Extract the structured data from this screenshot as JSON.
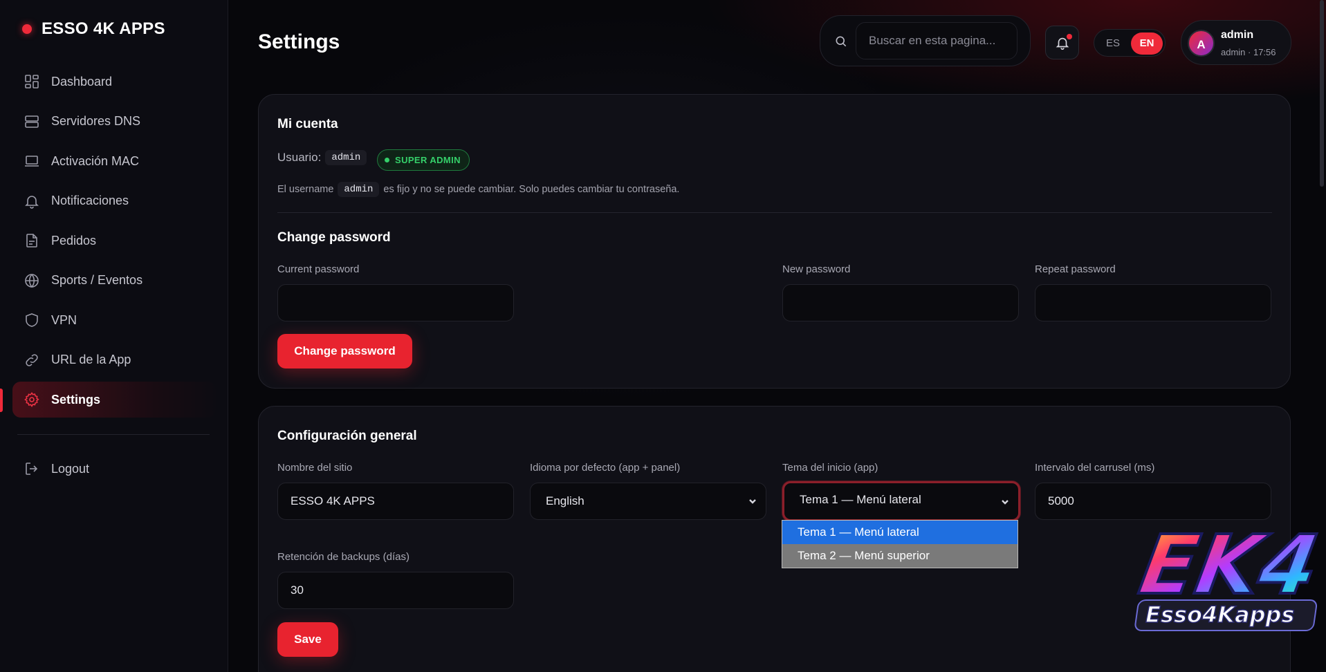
{
  "brand": {
    "name": "ESSO 4K APPS",
    "dot_color": "#ef2a3a"
  },
  "sidebar": {
    "items": [
      {
        "label": "Dashboard",
        "icon": "dashboard-icon"
      },
      {
        "label": "Servidores DNS",
        "icon": "server-icon"
      },
      {
        "label": "Activación MAC",
        "icon": "laptop-icon"
      },
      {
        "label": "Notificaciones",
        "icon": "bell-icon"
      },
      {
        "label": "Pedidos",
        "icon": "document-icon"
      },
      {
        "label": "Sports / Eventos",
        "icon": "globe-icon"
      },
      {
        "label": "VPN",
        "icon": "shield-icon"
      },
      {
        "label": "URL de la App",
        "icon": "link-icon"
      },
      {
        "label": "Settings",
        "icon": "gear-icon",
        "active": true
      }
    ],
    "logout_label": "Logout"
  },
  "header": {
    "title": "Settings",
    "search_placeholder": "Buscar en esta pagina...",
    "lang": {
      "es": "ES",
      "en": "EN",
      "selected": "EN"
    },
    "user": {
      "avatar_initial": "A",
      "name": "admin",
      "sub": "admin · 17:56"
    }
  },
  "account": {
    "title": "Mi cuenta",
    "user_label": "Usuario:",
    "username": "admin",
    "role_badge": "SUPER ADMIN",
    "note_prefix": "El username",
    "note_code": "admin",
    "note_suffix": "es fijo y no se puede cambiar. Solo puedes cambiar tu contraseña.",
    "change_password": {
      "title": "Change password",
      "current_label": "Current password",
      "new_label": "New password",
      "repeat_label": "Repeat password",
      "button": "Change password"
    }
  },
  "general": {
    "title": "Configuración general",
    "site_name_label": "Nombre del sitio",
    "site_name_value": "ESSO 4K APPS",
    "language_label": "Idioma por defecto (app + panel)",
    "language_value": "English",
    "theme_label": "Tema del inicio (app)",
    "theme_value": "Tema 1 — Menú lateral",
    "theme_options": [
      "Tema 1 — Menú lateral",
      "Tema 2 — Menú superior"
    ],
    "carousel_label": "Intervalo del carrusel (ms)",
    "carousel_value": "5000",
    "backup_label": "Retención de backups (días)",
    "backup_value": "30",
    "save_button": "Save"
  },
  "watermark": {
    "logo_top": "EK4",
    "logo_bottom": "Esso4Kapps"
  },
  "colors": {
    "accent": "#e8232f",
    "success": "#35d06a",
    "bg": "#07070b",
    "card": "#101017"
  }
}
